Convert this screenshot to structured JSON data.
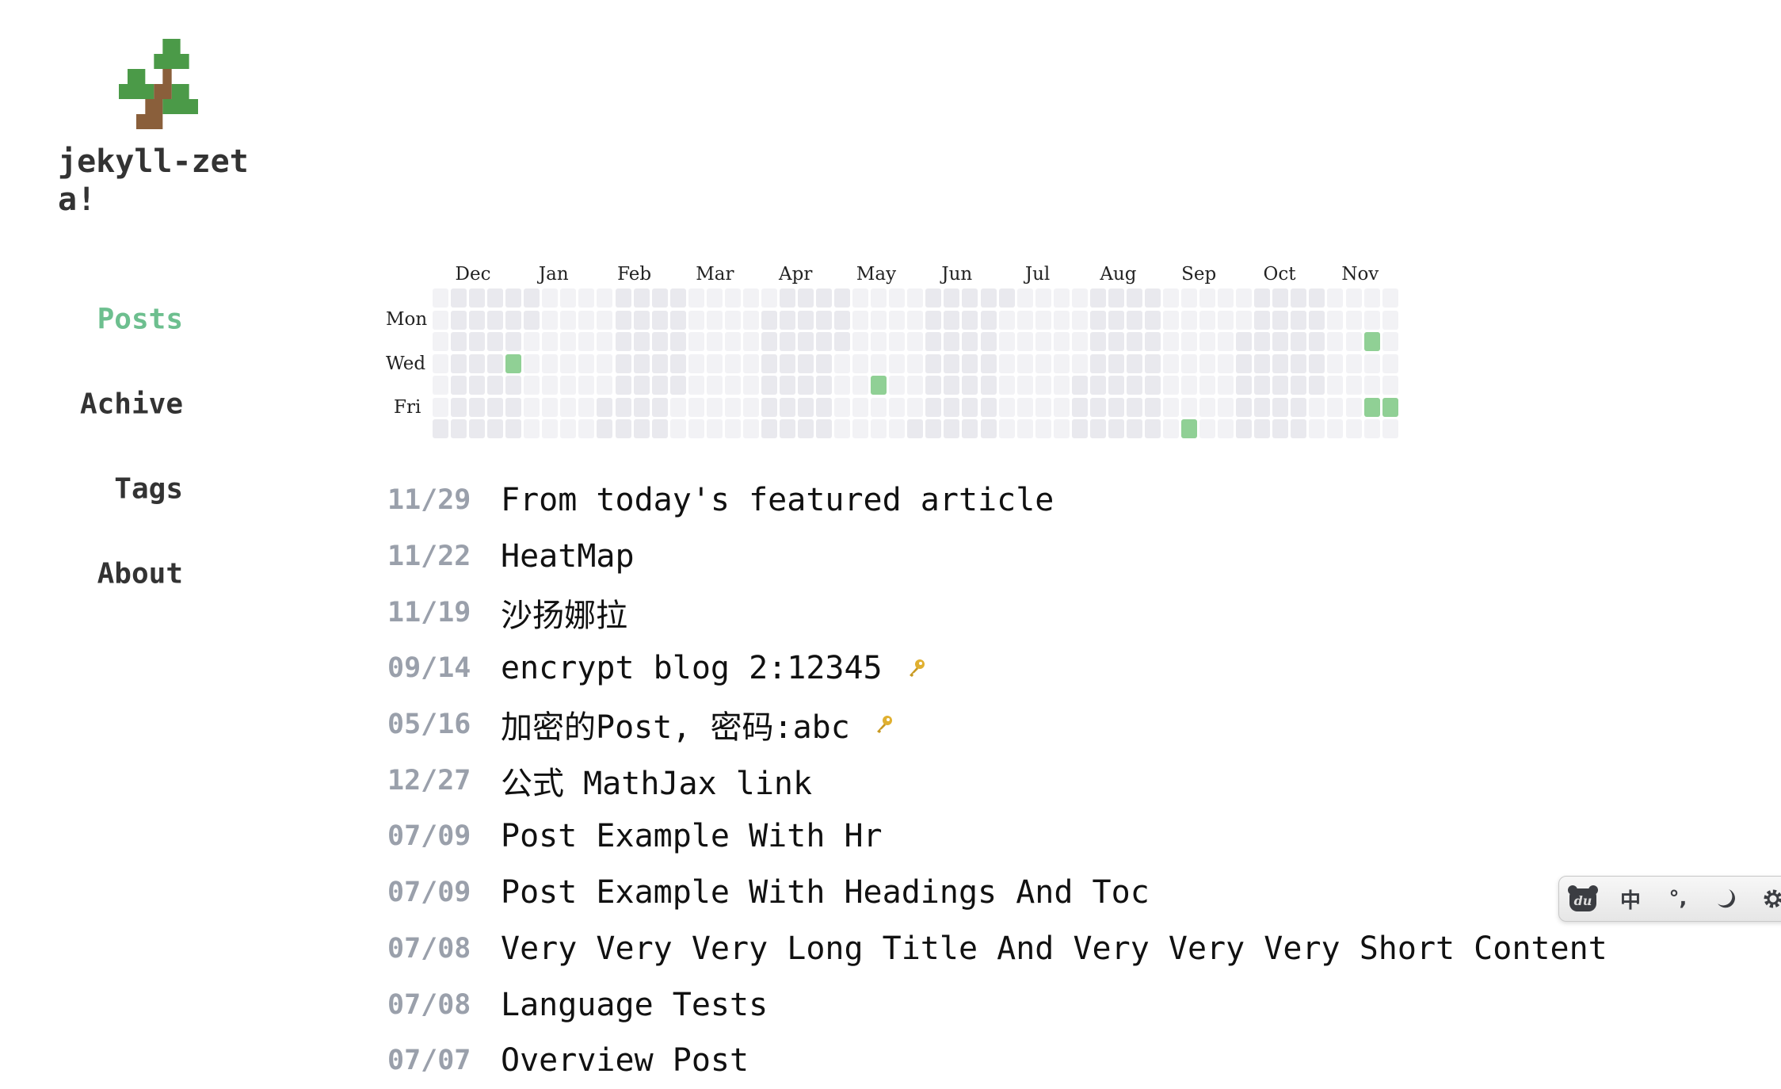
{
  "site": {
    "title": "jekyll-zeta!"
  },
  "nav": [
    {
      "label": "Posts",
      "active": true
    },
    {
      "label": "Achive",
      "active": false
    },
    {
      "label": "Tags",
      "active": false
    },
    {
      "label": "About",
      "active": false
    }
  ],
  "heatmap": {
    "months": [
      "Dec",
      "Jan",
      "Feb",
      "Mar",
      "Apr",
      "May",
      "Jun",
      "Jul",
      "Aug",
      "Sep",
      "Oct",
      "Nov"
    ],
    "day_labels": [
      "Mon",
      "Wed",
      "Fri"
    ],
    "start_date": "2018-11-25",
    "weeks": 53,
    "active_dates": [
      "2018-12-26",
      "2019-05-16",
      "2019-09-14",
      "2019-11-19",
      "2019-11-22",
      "2019-11-29"
    ],
    "colors": {
      "even_month": "#f2f2f5",
      "odd_month": "#e9e9ee",
      "active": "#90d095"
    }
  },
  "posts": [
    {
      "date": "11/29",
      "title": "From today's featured article",
      "locked": false
    },
    {
      "date": "11/22",
      "title": "HeatMap",
      "locked": false
    },
    {
      "date": "11/19",
      "title": "沙扬娜拉",
      "locked": false
    },
    {
      "date": "09/14",
      "title": "encrypt blog 2:12345",
      "locked": true
    },
    {
      "date": "05/16",
      "title": "加密的Post, 密码:abc",
      "locked": true
    },
    {
      "date": "12/27",
      "title": "公式 MathJax link",
      "locked": false
    },
    {
      "date": "07/09",
      "title": "Post Example With Hr",
      "locked": false
    },
    {
      "date": "07/09",
      "title": "Post Example With Headings And Toc",
      "locked": false
    },
    {
      "date": "07/08",
      "title": "Very Very Very Long Title And Very Very Very Short Content",
      "locked": false
    },
    {
      "date": "07/08",
      "title": "Language Tests",
      "locked": false
    },
    {
      "date": "07/07",
      "title": "Overview Post",
      "locked": false
    }
  ],
  "ime_toolbar": {
    "logo": "du",
    "mode": "中",
    "punct": "°,"
  }
}
